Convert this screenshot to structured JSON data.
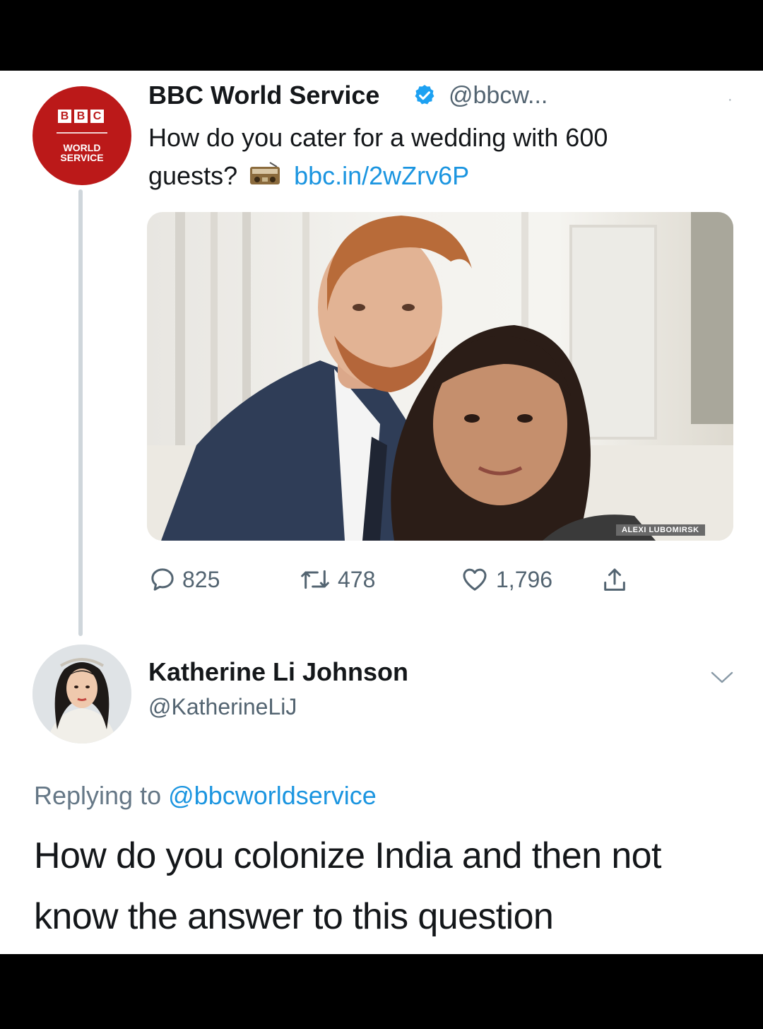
{
  "tweet": {
    "author_name": "BBC World Service",
    "author_handle": "@bbcw...",
    "avatar": {
      "logo_letters": [
        "B",
        "B",
        "C"
      ],
      "logo_subtitle_line1": "WORLD",
      "logo_subtitle_line2": "SERVICE"
    },
    "text_line1": "How do you cater for a wedding with 600",
    "text_line2": "guests?",
    "link": "bbc.in/2wZrv6P",
    "radio_icon": "radio-icon",
    "image": {
      "photo_credit": "ALEXI LUBOMIRSK"
    },
    "actions": {
      "replies": "825",
      "retweets": "478",
      "likes": "1,796"
    },
    "colors": {
      "brand_red": "#bb1919",
      "link_blue": "#1b95e0",
      "verified_blue": "#1da1f2"
    }
  },
  "reply": {
    "author_name": "Katherine Li Johnson",
    "author_handle": "@KatherineLiJ",
    "replying_prefix": "Replying to",
    "replying_handle": "@bbcworldservice",
    "text": "How do you colonize India and then not know the answer to this question"
  }
}
